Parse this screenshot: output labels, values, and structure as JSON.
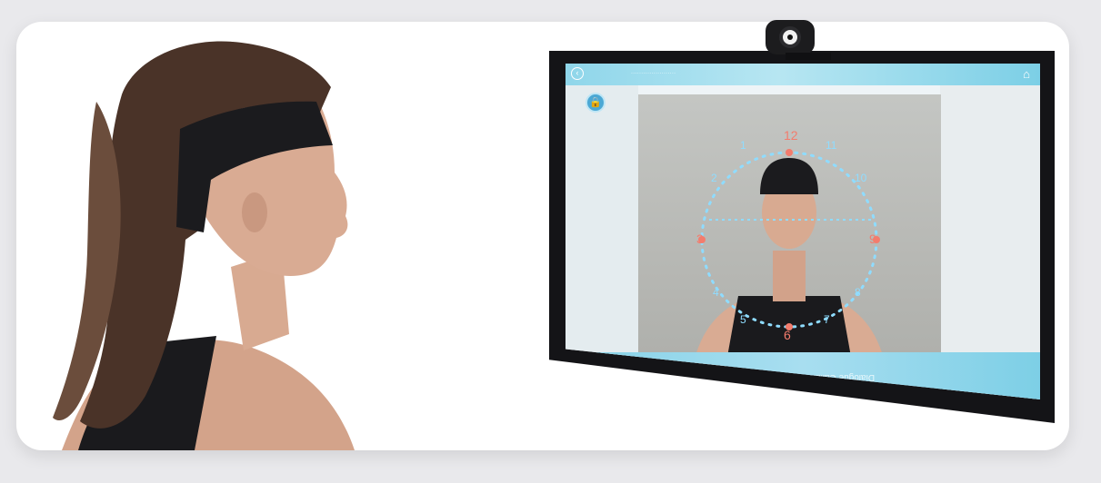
{
  "screen": {
    "topbar_text": "......................",
    "bottom_label": "Dialogue Calibration",
    "clock_numbers": [
      "12",
      "11",
      "10",
      "9",
      "8",
      "7",
      "6",
      "5",
      "4",
      "3",
      "2",
      "1"
    ]
  },
  "icons": {
    "back": "back-icon",
    "home": "home-icon",
    "lock": "lock-icon"
  },
  "colors": {
    "accent": "#86d2e7",
    "dot": "#8fdcff",
    "highlight": "#f37c6d"
  }
}
